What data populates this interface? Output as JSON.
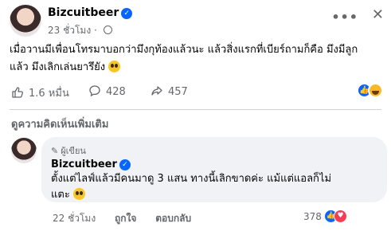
{
  "post": {
    "author": "Bizcuitbeer",
    "time": "23 ชั่วโมง",
    "separator": "·",
    "text_line1": "เมื่อวานมีเพื่อนโทรมาบอกว่ามึงกุท้องแล้วนะ แล้วสิ่งแรกที่เบียร์ถามก็คือ มึงมีลูก",
    "text_line2": "แล้ว มึงเลิกเล่นยารึยัง",
    "more_glyph": "•••",
    "close_glyph": "✕"
  },
  "actions": {
    "likes": "1.6 หมื่น",
    "comments": "428",
    "shares": "457"
  },
  "comments_section": {
    "more_comments_label": "ดูความคิดเห็นเพิ่มเติม"
  },
  "comment": {
    "badge": "ผู้เขียน",
    "author": "Bizcuitbeer",
    "text_line1": "ตั้งแต่ไลฟ์แล้วมีคนมาดู 3 แสน ทางนี้เลิกขาดค่ะ แม้แต่แอลก็ไม่",
    "text_line2": "แตะ",
    "time": "22 ชั่วโมง",
    "like_label": "ถูกใจ",
    "reply_label": "ตอบกลับ",
    "reaction_count": "378"
  },
  "icons": {
    "verified": "verified-badge-icon",
    "globe": "globe-icon",
    "like": "like-icon",
    "comment": "comment-icon",
    "share": "share-icon",
    "haha": "haha-reaction-icon",
    "heart": "heart-reaction-icon",
    "pen": "pen-icon",
    "emoji": "pleading-face-emoji"
  },
  "colors": {
    "brand_blue": "#0866ff",
    "secondary_text": "#65676b",
    "bubble_bg": "#f0f2f5",
    "heart_red": "#f33e58"
  }
}
